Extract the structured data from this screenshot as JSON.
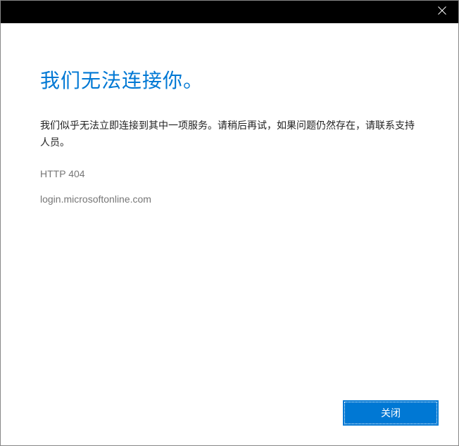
{
  "dialog": {
    "heading": "我们无法连接你。",
    "message": "我们似乎无法立即连接到其中一项服务。请稍后再试，如果问题仍然存在，请联系支持人员。",
    "error_code": "HTTP 404",
    "domain": "login.microsoftonline.com",
    "close_button_label": "关闭"
  }
}
